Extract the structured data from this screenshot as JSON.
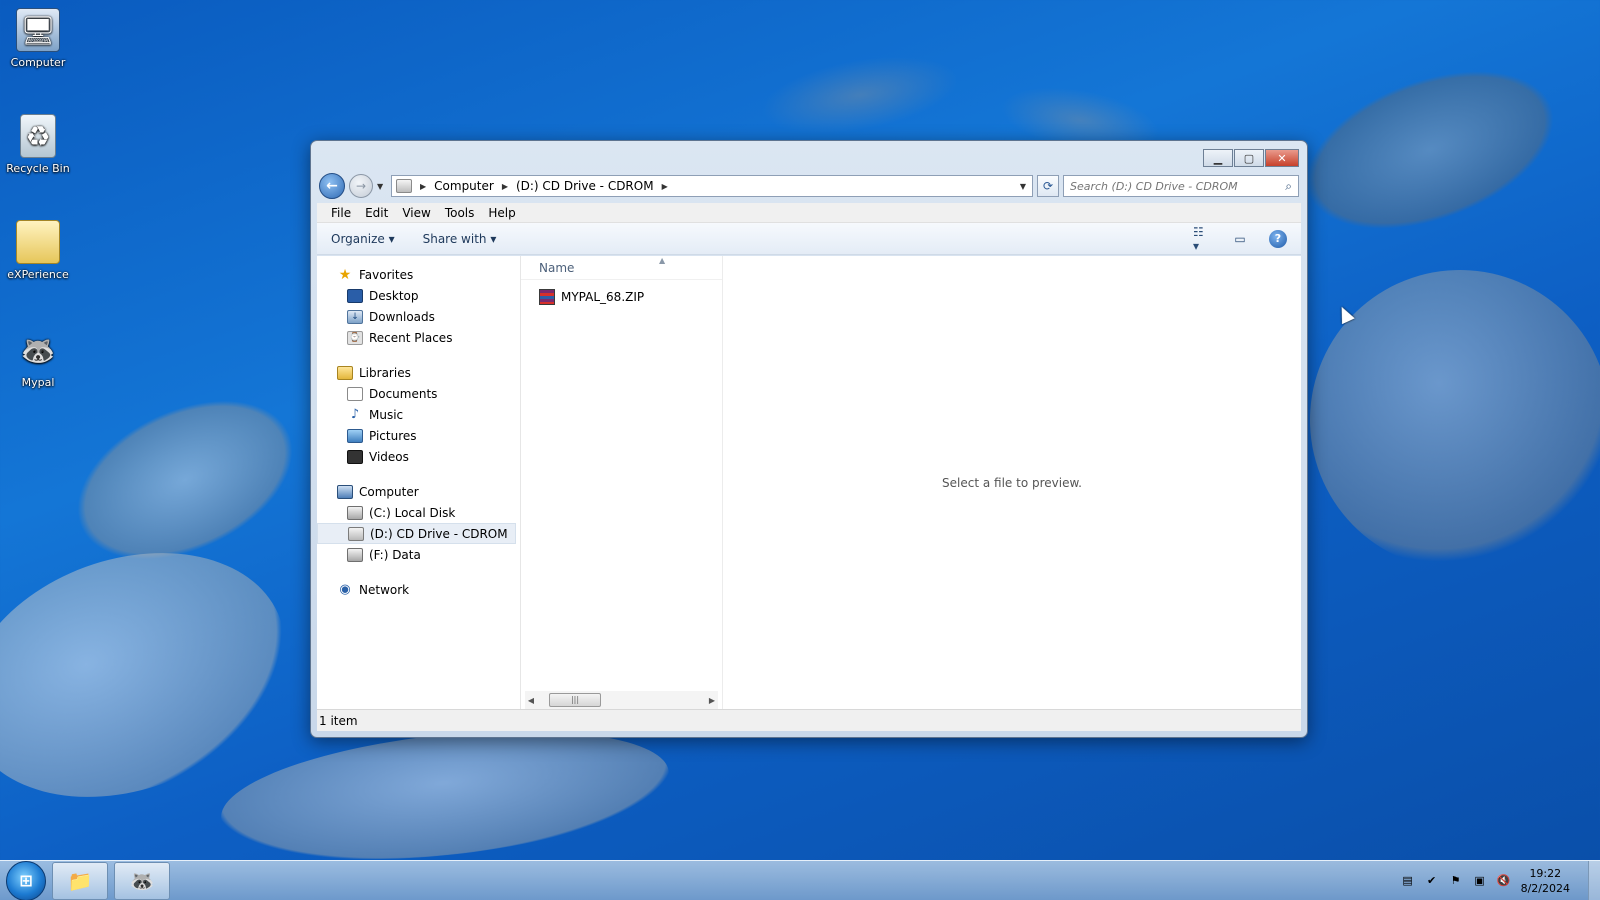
{
  "desktop": {
    "icons": [
      {
        "label": "Computer"
      },
      {
        "label": "Recycle Bin"
      },
      {
        "label": "eXPerience"
      },
      {
        "label": "Mypal"
      }
    ]
  },
  "window": {
    "breadcrumb": [
      "Computer",
      "(D:) CD Drive - CDROM"
    ],
    "search_placeholder": "Search (D:) CD Drive - CDROM",
    "menu": [
      "File",
      "Edit",
      "View",
      "Tools",
      "Help"
    ],
    "toolbar": {
      "organize": "Organize ▾",
      "share_with": "Share with ▾"
    },
    "navpane": {
      "favorites": {
        "label": "Favorites",
        "items": [
          "Desktop",
          "Downloads",
          "Recent Places"
        ]
      },
      "libraries": {
        "label": "Libraries",
        "items": [
          "Documents",
          "Music",
          "Pictures",
          "Videos"
        ]
      },
      "computer": {
        "label": "Computer",
        "items": [
          "(C:) Local Disk",
          "(D:) CD Drive - CDROM",
          "(F:) Data"
        ],
        "selected": "(D:) CD Drive - CDROM"
      },
      "network": {
        "label": "Network"
      }
    },
    "files": {
      "column_name": "Name",
      "items": [
        {
          "name": "MYPAL_68.ZIP"
        }
      ]
    },
    "preview_text": "Select a file to preview.",
    "status": "1 item"
  },
  "taskbar": {
    "clock_time": "19:22",
    "clock_date": "8/2/2024"
  }
}
